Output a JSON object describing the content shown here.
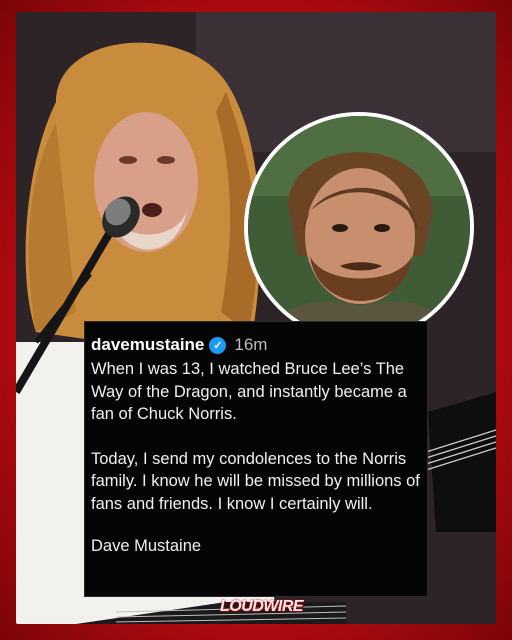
{
  "post": {
    "username": "davemustaine",
    "verified_icon": "verified-badge-icon",
    "time": "16m",
    "paragraph_1": "When I was 13, I watched Bruce Lee’s The Way of the Dragon, and instantly became a fan of Chuck Norris.",
    "paragraph_2": "Today, I send my condolences to the Norris family. I know he will be missed by millions of fans and friends. I know I certainly will.",
    "signature": "Dave Mustaine"
  },
  "branding": {
    "logo_text": "LOUDWIRE"
  },
  "colors": {
    "frame_red": "#d0141a",
    "verified_blue": "#1d9bf0",
    "card_bg": "#050505"
  }
}
